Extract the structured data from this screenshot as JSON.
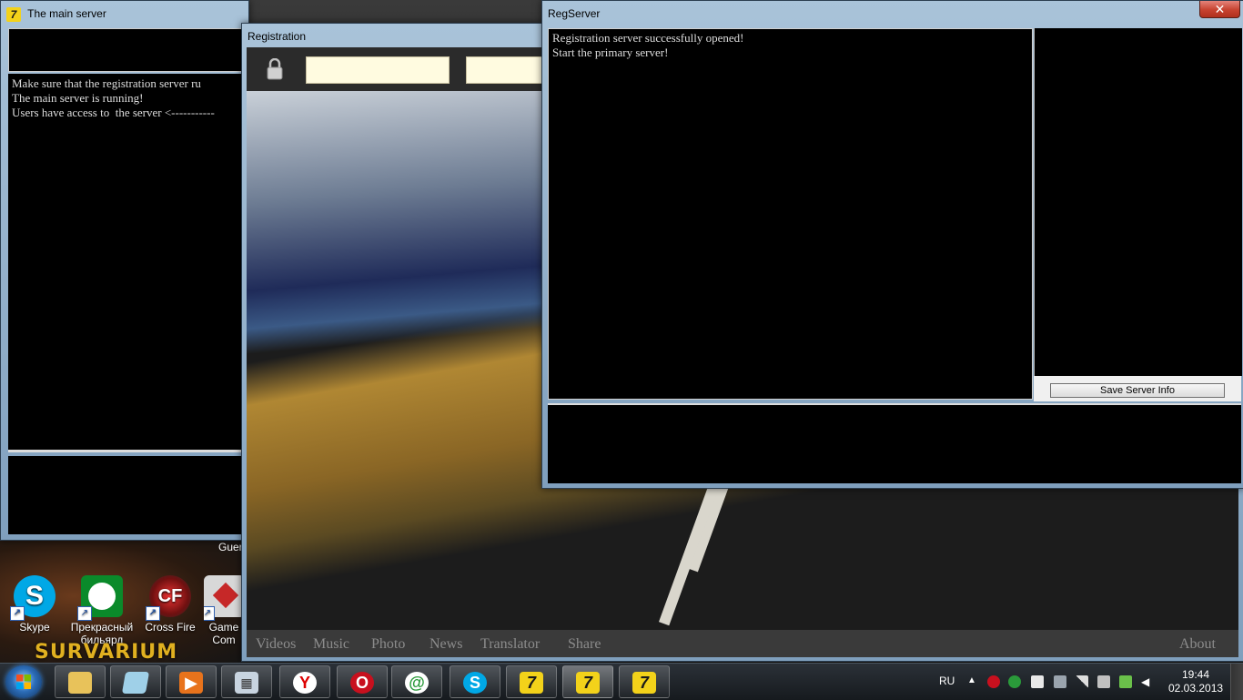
{
  "main_server_window": {
    "title": "The main server",
    "log": "Make sure that the registration server ru\nThe main server is running!\nUsers have access to  the server <-----------"
  },
  "registration_window": {
    "title": "Registration",
    "nav": [
      "Videos",
      "Music",
      "Photo",
      "News",
      "Translator",
      "Share"
    ],
    "nav_right": "About"
  },
  "regserver_window": {
    "title": "RegServer",
    "close_glyph": "✕",
    "log_lines": [
      "Registration server successfully opened!",
      "Start the primary server!"
    ],
    "save_button": "Save Server Info"
  },
  "desktop": {
    "icons": [
      {
        "label": "Skype"
      },
      {
        "label": "Прекрасный бильярд"
      },
      {
        "label": "Cross Fire"
      },
      {
        "label": "Game Com"
      }
    ],
    "guest_label": "Guer",
    "survarium_logo": "SURVARIUM"
  },
  "taskbar": {
    "language": "RU",
    "time": "19:44",
    "date": "02.03.2013",
    "buttons": [
      "explorer",
      "notes",
      "media-player",
      "calculator",
      "yandex",
      "opera",
      "mail-agent",
      "skype",
      "server-app",
      "server-app",
      "server-app"
    ]
  },
  "colors": {
    "log_bg": "#000000",
    "field_bg": "#fffbe0",
    "close_red": "#c7422f"
  }
}
